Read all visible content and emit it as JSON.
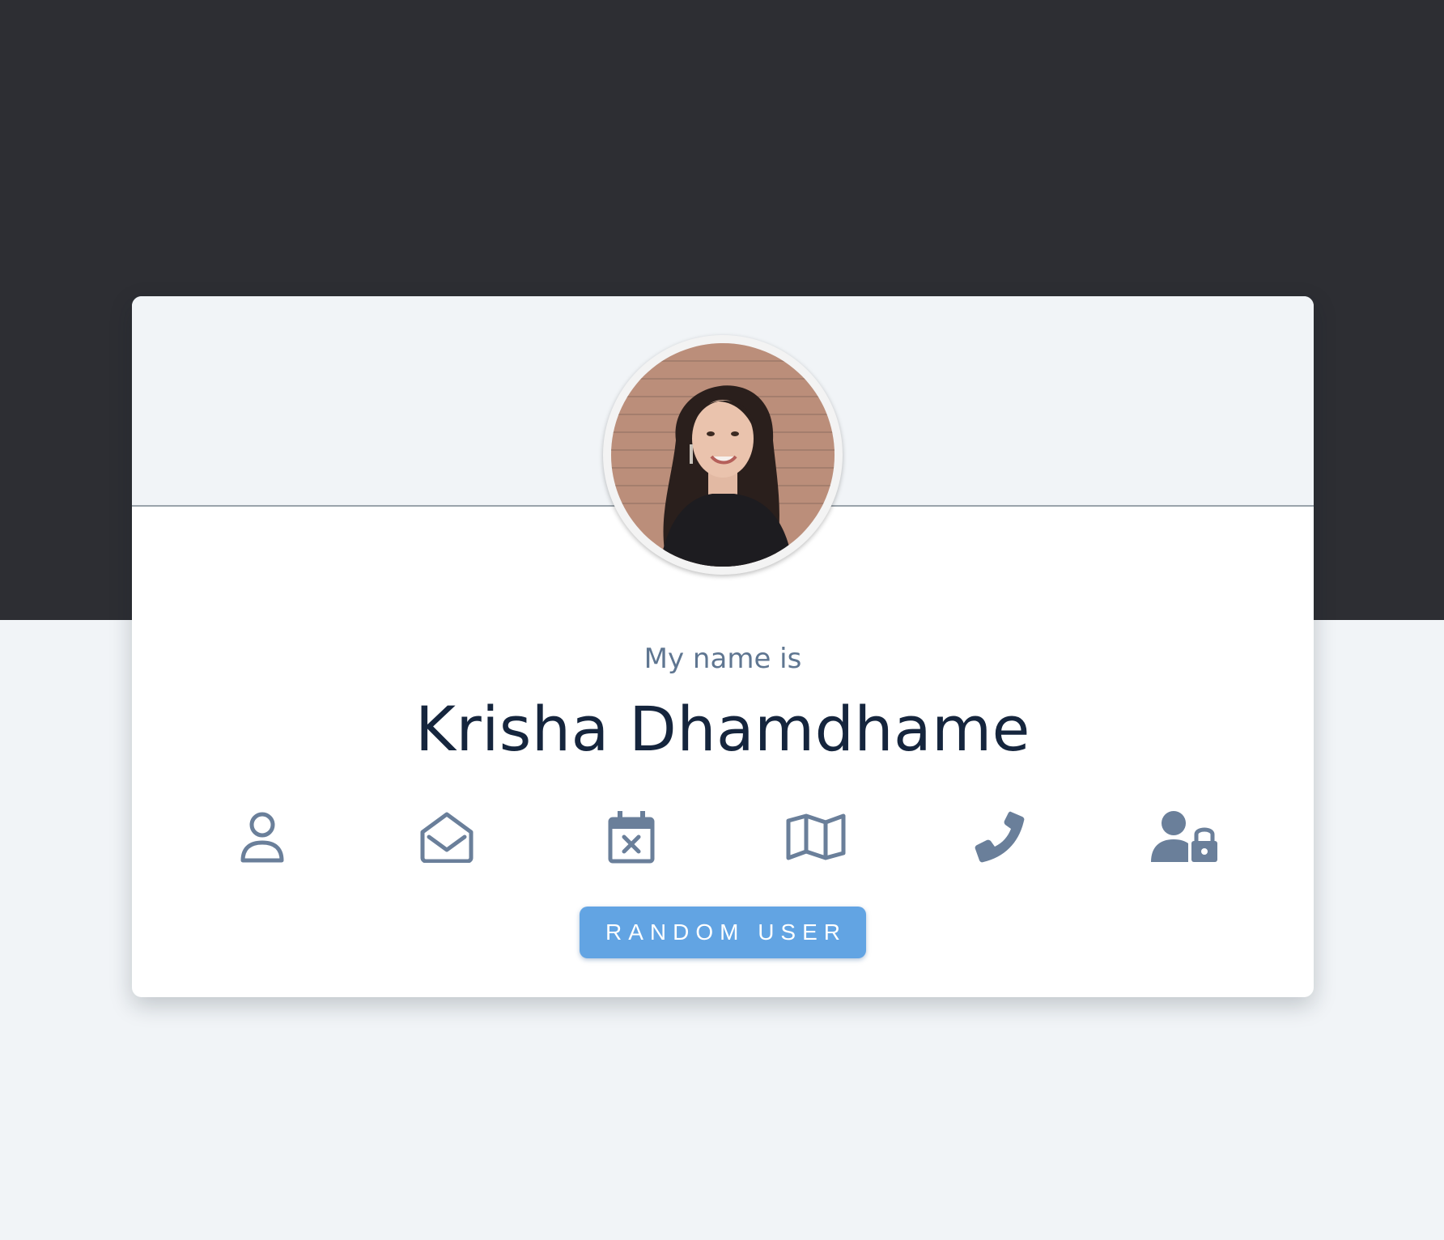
{
  "profile": {
    "intro_label": "My name is",
    "name": "Krisha Dhamdhame"
  },
  "icons": [
    {
      "name": "user-icon"
    },
    {
      "name": "envelope-open-icon"
    },
    {
      "name": "calendar-x-icon"
    },
    {
      "name": "map-icon"
    },
    {
      "name": "phone-icon"
    },
    {
      "name": "user-lock-icon"
    }
  ],
  "button": {
    "label": "RANDOM USER"
  },
  "colors": {
    "accent": "#62a4e3",
    "icon": "#6a7f9a",
    "dark_band": "#2d2e33",
    "background": "#f1f4f7",
    "name_text": "#15253d",
    "label_text": "#5f7691"
  }
}
